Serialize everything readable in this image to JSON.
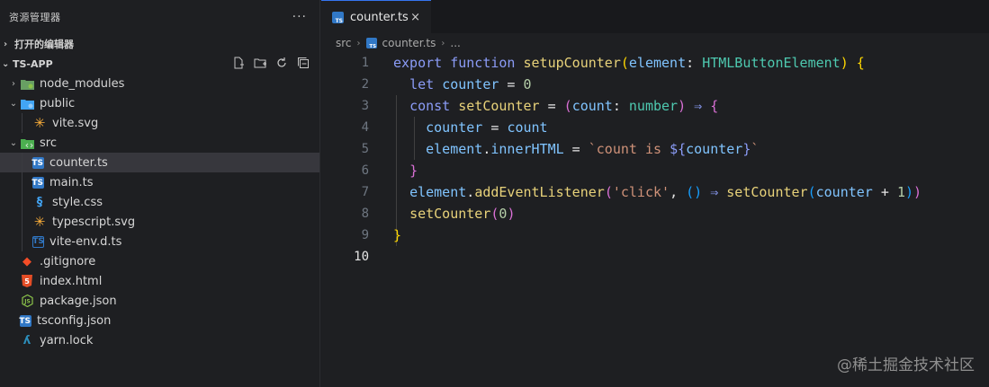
{
  "explorer": {
    "title": "资源管理器",
    "more": "···",
    "open_editors": "打开的编辑器",
    "project": "TS-APP",
    "actions": [
      "new-file-icon",
      "new-folder-icon",
      "refresh-icon",
      "collapse-all-icon"
    ],
    "items": [
      {
        "name": "node_modules",
        "type": "folder",
        "icon": "node-folder-icon"
      },
      {
        "name": "public",
        "type": "folder-open",
        "icon": "public-folder-icon"
      },
      {
        "name": "vite.svg",
        "type": "file",
        "icon": "vite-icon"
      },
      {
        "name": "src",
        "type": "folder-open",
        "icon": "src-folder-icon"
      },
      {
        "name": "counter.ts",
        "type": "file",
        "icon": "typescript-icon"
      },
      {
        "name": "main.ts",
        "type": "file",
        "icon": "typescript-icon"
      },
      {
        "name": "style.css",
        "type": "file",
        "icon": "css-icon"
      },
      {
        "name": "typescript.svg",
        "type": "file",
        "icon": "svg-icon"
      },
      {
        "name": "vite-env.d.ts",
        "type": "file",
        "icon": "typescript-def-icon"
      },
      {
        "name": ".gitignore",
        "type": "file",
        "icon": "git-icon"
      },
      {
        "name": "index.html",
        "type": "file",
        "icon": "html-icon"
      },
      {
        "name": "package.json",
        "type": "file",
        "icon": "nodejs-icon"
      },
      {
        "name": "tsconfig.json",
        "type": "file",
        "icon": "tsconfig-icon"
      },
      {
        "name": "yarn.lock",
        "type": "file",
        "icon": "yarn-icon"
      }
    ]
  },
  "editor": {
    "tab_label": "counter.ts",
    "tab_close": "×",
    "breadcrumb": [
      "src",
      "counter.ts",
      "..."
    ],
    "line_numbers": [
      "1",
      "2",
      "3",
      "4",
      "5",
      "6",
      "7",
      "8",
      "9",
      "10"
    ],
    "active_line": "10"
  },
  "watermark": "@稀土掘金技术社区",
  "colors": {
    "background": "#1e1f22",
    "selection": "#37373d",
    "tab_accent": "#3574f0",
    "ts_blue": "#3178c6"
  }
}
